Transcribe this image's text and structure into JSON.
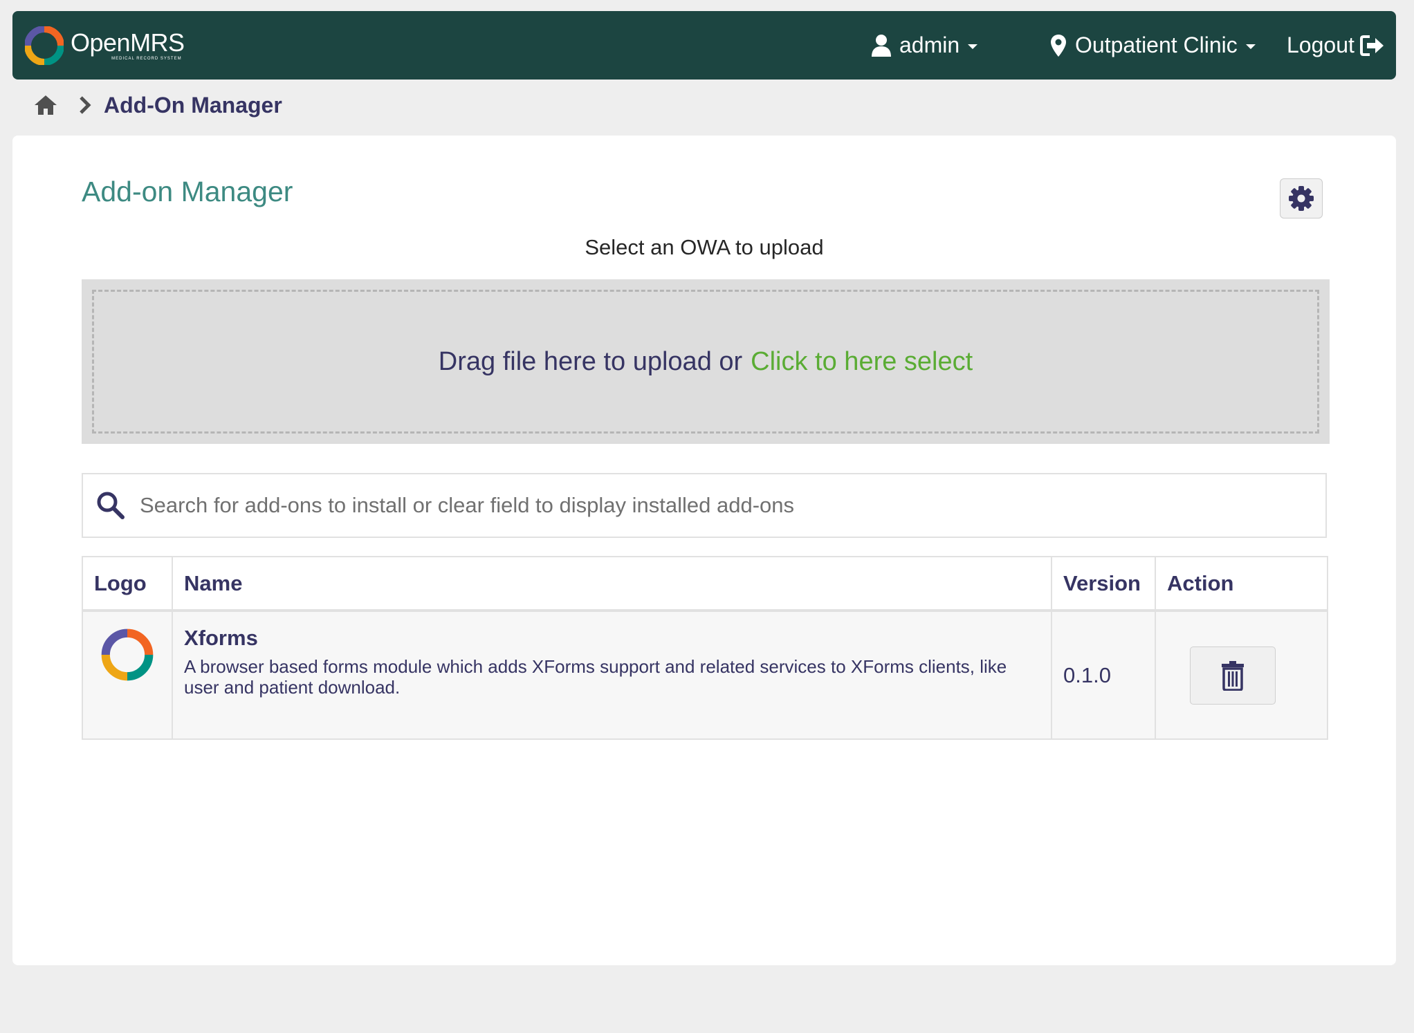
{
  "header": {
    "brand_name": "OpenMRS",
    "brand_tagline": "MEDICAL RECORD SYSTEM",
    "user_label": "admin",
    "location_label": "Outpatient Clinic",
    "logout_label": "Logout"
  },
  "breadcrumb": {
    "current": "Add-On Manager"
  },
  "main": {
    "title": "Add-on Manager",
    "upload_caption": "Select an OWA to upload",
    "dropzone_text": "Drag file here to upload or",
    "dropzone_link": "Click to here select",
    "search_placeholder": "Search for add-ons to install or clear field to display installed add-ons",
    "search_value": ""
  },
  "table": {
    "columns": [
      "Logo",
      "Name",
      "Version",
      "Action"
    ],
    "rows": [
      {
        "name": "Xforms",
        "description": "A browser based forms module which adds XForms support and related services to XForms clients, like user and patient download.",
        "version": "0.1.0"
      }
    ]
  },
  "colors": {
    "header_bg": "#1c4541",
    "title": "#3d8a82",
    "link_green": "#5aac34",
    "text_dark": "#363463"
  },
  "icons": {
    "home": "home-icon",
    "chevron": "chevron-right-icon",
    "user": "user-icon",
    "location": "map-marker-icon",
    "logout": "sign-out-icon",
    "settings": "gear-icon",
    "search": "search-icon",
    "delete": "trash-icon"
  }
}
